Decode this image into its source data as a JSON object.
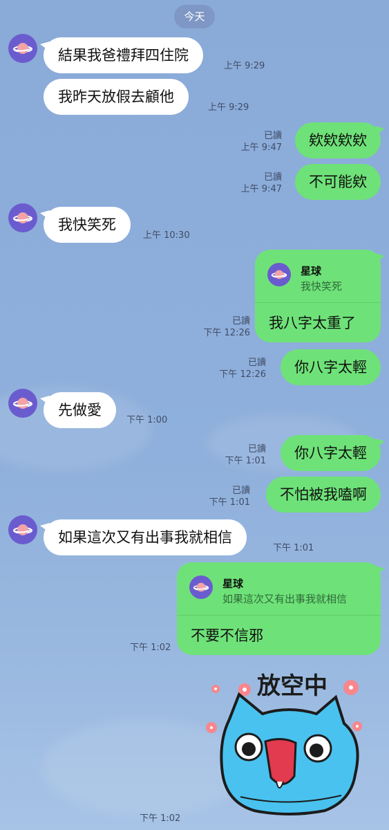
{
  "chat": {
    "date_label": "今天",
    "contact_name": "星球",
    "messages": [
      {
        "side": "in",
        "text": "結果我爸禮拜四住院",
        "time": "上午 9:29"
      },
      {
        "side": "in",
        "text": "我昨天放假去顧他",
        "time": "上午 9:29"
      },
      {
        "side": "out",
        "text": "欸欸欸欸",
        "read": "已讀",
        "time": "上午 9:47"
      },
      {
        "side": "out",
        "text": "不可能欸",
        "read": "已讀",
        "time": "上午 9:47"
      },
      {
        "side": "in",
        "text": "我快笑死",
        "time": "上午 10:30"
      },
      {
        "side": "out",
        "reply_to_name": "星球",
        "reply_to_text": "我快笑死",
        "text": "我八字太重了",
        "read": "已讀",
        "time": "下午 12:26"
      },
      {
        "side": "out",
        "text": "你八字太輕",
        "read": "已讀",
        "time": "下午 12:26"
      },
      {
        "side": "in",
        "text": "先做愛",
        "time": "下午 1:00"
      },
      {
        "side": "out",
        "text": "你八字太輕",
        "read": "已讀",
        "time": "下午 1:01"
      },
      {
        "side": "out",
        "text": "不怕被我嗑啊",
        "read": "已讀",
        "time": "下午 1:01"
      },
      {
        "side": "in",
        "text": "如果這次又有出事我就相信",
        "time": "下午 1:01"
      },
      {
        "side": "out",
        "reply_to_name": "星球",
        "reply_to_text": "如果這次又有出事我就相信",
        "text": "不要不信邪",
        "time": "下午 1:02"
      },
      {
        "side": "out",
        "type": "sticker",
        "sticker_text": "放空中",
        "sticker_icon": "blue-cat-sticker",
        "time": "下午 1:02"
      }
    ]
  },
  "colors": {
    "background": "#8aaad8",
    "bubble_in": "#ffffff",
    "bubble_out": "#6ee278",
    "avatar": "#6a5ccf",
    "planet": "#f2a3a6"
  }
}
